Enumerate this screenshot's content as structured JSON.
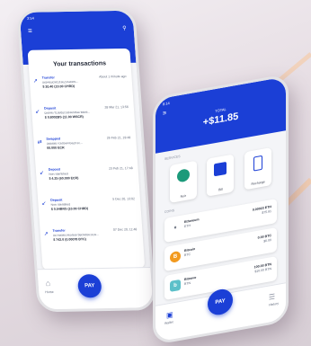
{
  "colors": {
    "brand": "#1b3fd6",
    "accent_line": "#f6c8a0"
  },
  "back_phone": {
    "time": "3:54",
    "title": "Your transactions",
    "transactions": [
      {
        "icon": "arrow-up-right-icon",
        "type": "Transfer",
        "detail": "0xb4a3c9d1f3e2c4a5b6...",
        "date": "About 1 minute ago",
        "amount": "$ 20.40 (10.00 CHRD)"
      },
      {
        "icon": "arrow-down-left-icon",
        "type": "Deposit",
        "detail": "0xd4e7f1a9b2c3d4e5f6a7b8c9...",
        "date": "28 Mar 21, 13:56",
        "amount": "$ 0.8002BS (11.00 WSCR)"
      },
      {
        "icon": "swap-icon",
        "type": "Swapped",
        "detail": "0x8a9b7c6d5e4f3a2b1c...",
        "date": "26 Feb 21, 19:48",
        "amount": "00.000 ECR"
      },
      {
        "icon": "arrow-down-left-icon",
        "type": "Deposit",
        "detail": "Non Identified",
        "date": "23 Feb 21, 17:48",
        "amount": "$ 4.25 (60.000 ECR)"
      },
      {
        "icon": "arrow-down-left-icon",
        "type": "Deposit",
        "detail": "Non Identified",
        "date": "5 Dec 20, 13:02",
        "amount": "$ 0.54BRS (10.00 CHRD)"
      },
      {
        "icon": "arrow-up-right-icon",
        "type": "Transfer",
        "detail": "0x7ea9bc4e5f6a7b8c9d0e1f2a...",
        "date": "07 Dec 20, 11:48",
        "amount": "$ 742.0 (0.00078 BTC)"
      }
    ],
    "nav_home": "Home",
    "pay": "PAY"
  },
  "front_phone": {
    "time": "8:14",
    "total_label": "TOTAL",
    "total_value": "+$11.85",
    "services_label": "SERVICES",
    "services": [
      {
        "label": "Noir",
        "color": "#1b9a7a"
      },
      {
        "label": "Bill",
        "color": "#1b3fd6"
      },
      {
        "label": "Recharge",
        "color": "#1b3fd6"
      }
    ],
    "coins_label": "COINS",
    "coins": [
      {
        "name": "Ethereum",
        "symbol": "ETH",
        "amount": "0.00023 ETH",
        "usd": "$75.91",
        "color": "#6b7280",
        "glyph": "♦"
      },
      {
        "name": "Bitcoin",
        "symbol": "BTC",
        "amount": "0.00 BTC",
        "usd": "$0.00",
        "color": "#f29a1f",
        "glyph": "B"
      },
      {
        "name": "Bitnovo",
        "symbol": "BTN",
        "amount": "100.00 BTN",
        "usd": "$10.00 BTN",
        "color": "#5cc0c9",
        "glyph": "b"
      }
    ],
    "pay": "PAY",
    "nav_wallet": "Wallet",
    "nav_history": "History"
  }
}
